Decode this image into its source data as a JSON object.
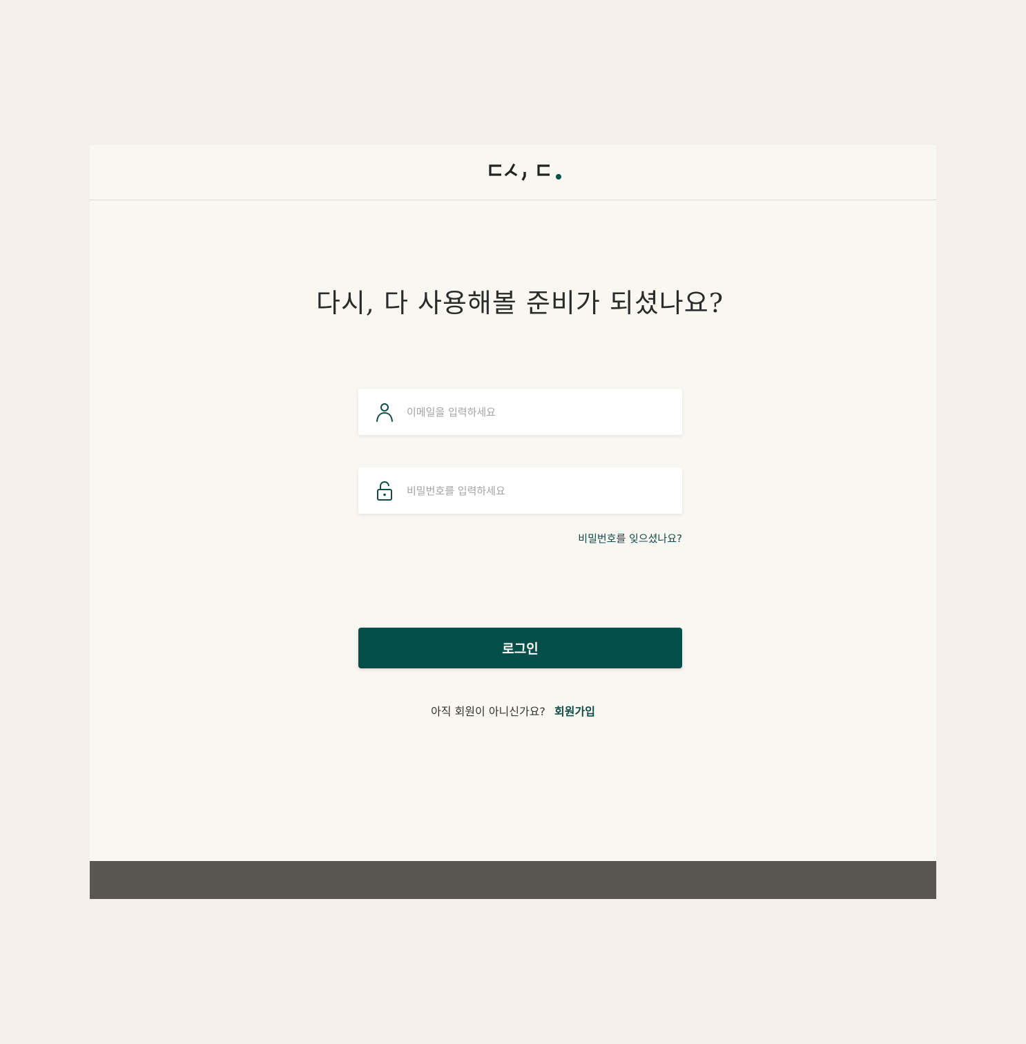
{
  "logo": {
    "text": "ㄷㅅ, ㄷ",
    "dot_color": "#044f4a"
  },
  "main": {
    "title": "다시, 다 사용해볼 준비가 되셨나요?"
  },
  "form": {
    "email": {
      "placeholder": "이메일을 입력하세요",
      "value": "",
      "icon": "user-icon"
    },
    "password": {
      "placeholder": "비밀번호를 입력하세요",
      "value": "",
      "icon": "lock-icon"
    },
    "forgot_label": "비밀번호를 잊으셨나요?",
    "login_label": "로그인",
    "signup_prompt": "아직 회원이 아니신가요?",
    "signup_label": "회원가입"
  },
  "colors": {
    "accent": "#044f4a",
    "page_bg": "#f4f0e9",
    "card_bg": "#f9f7f2",
    "footer_bg": "#59554f"
  }
}
